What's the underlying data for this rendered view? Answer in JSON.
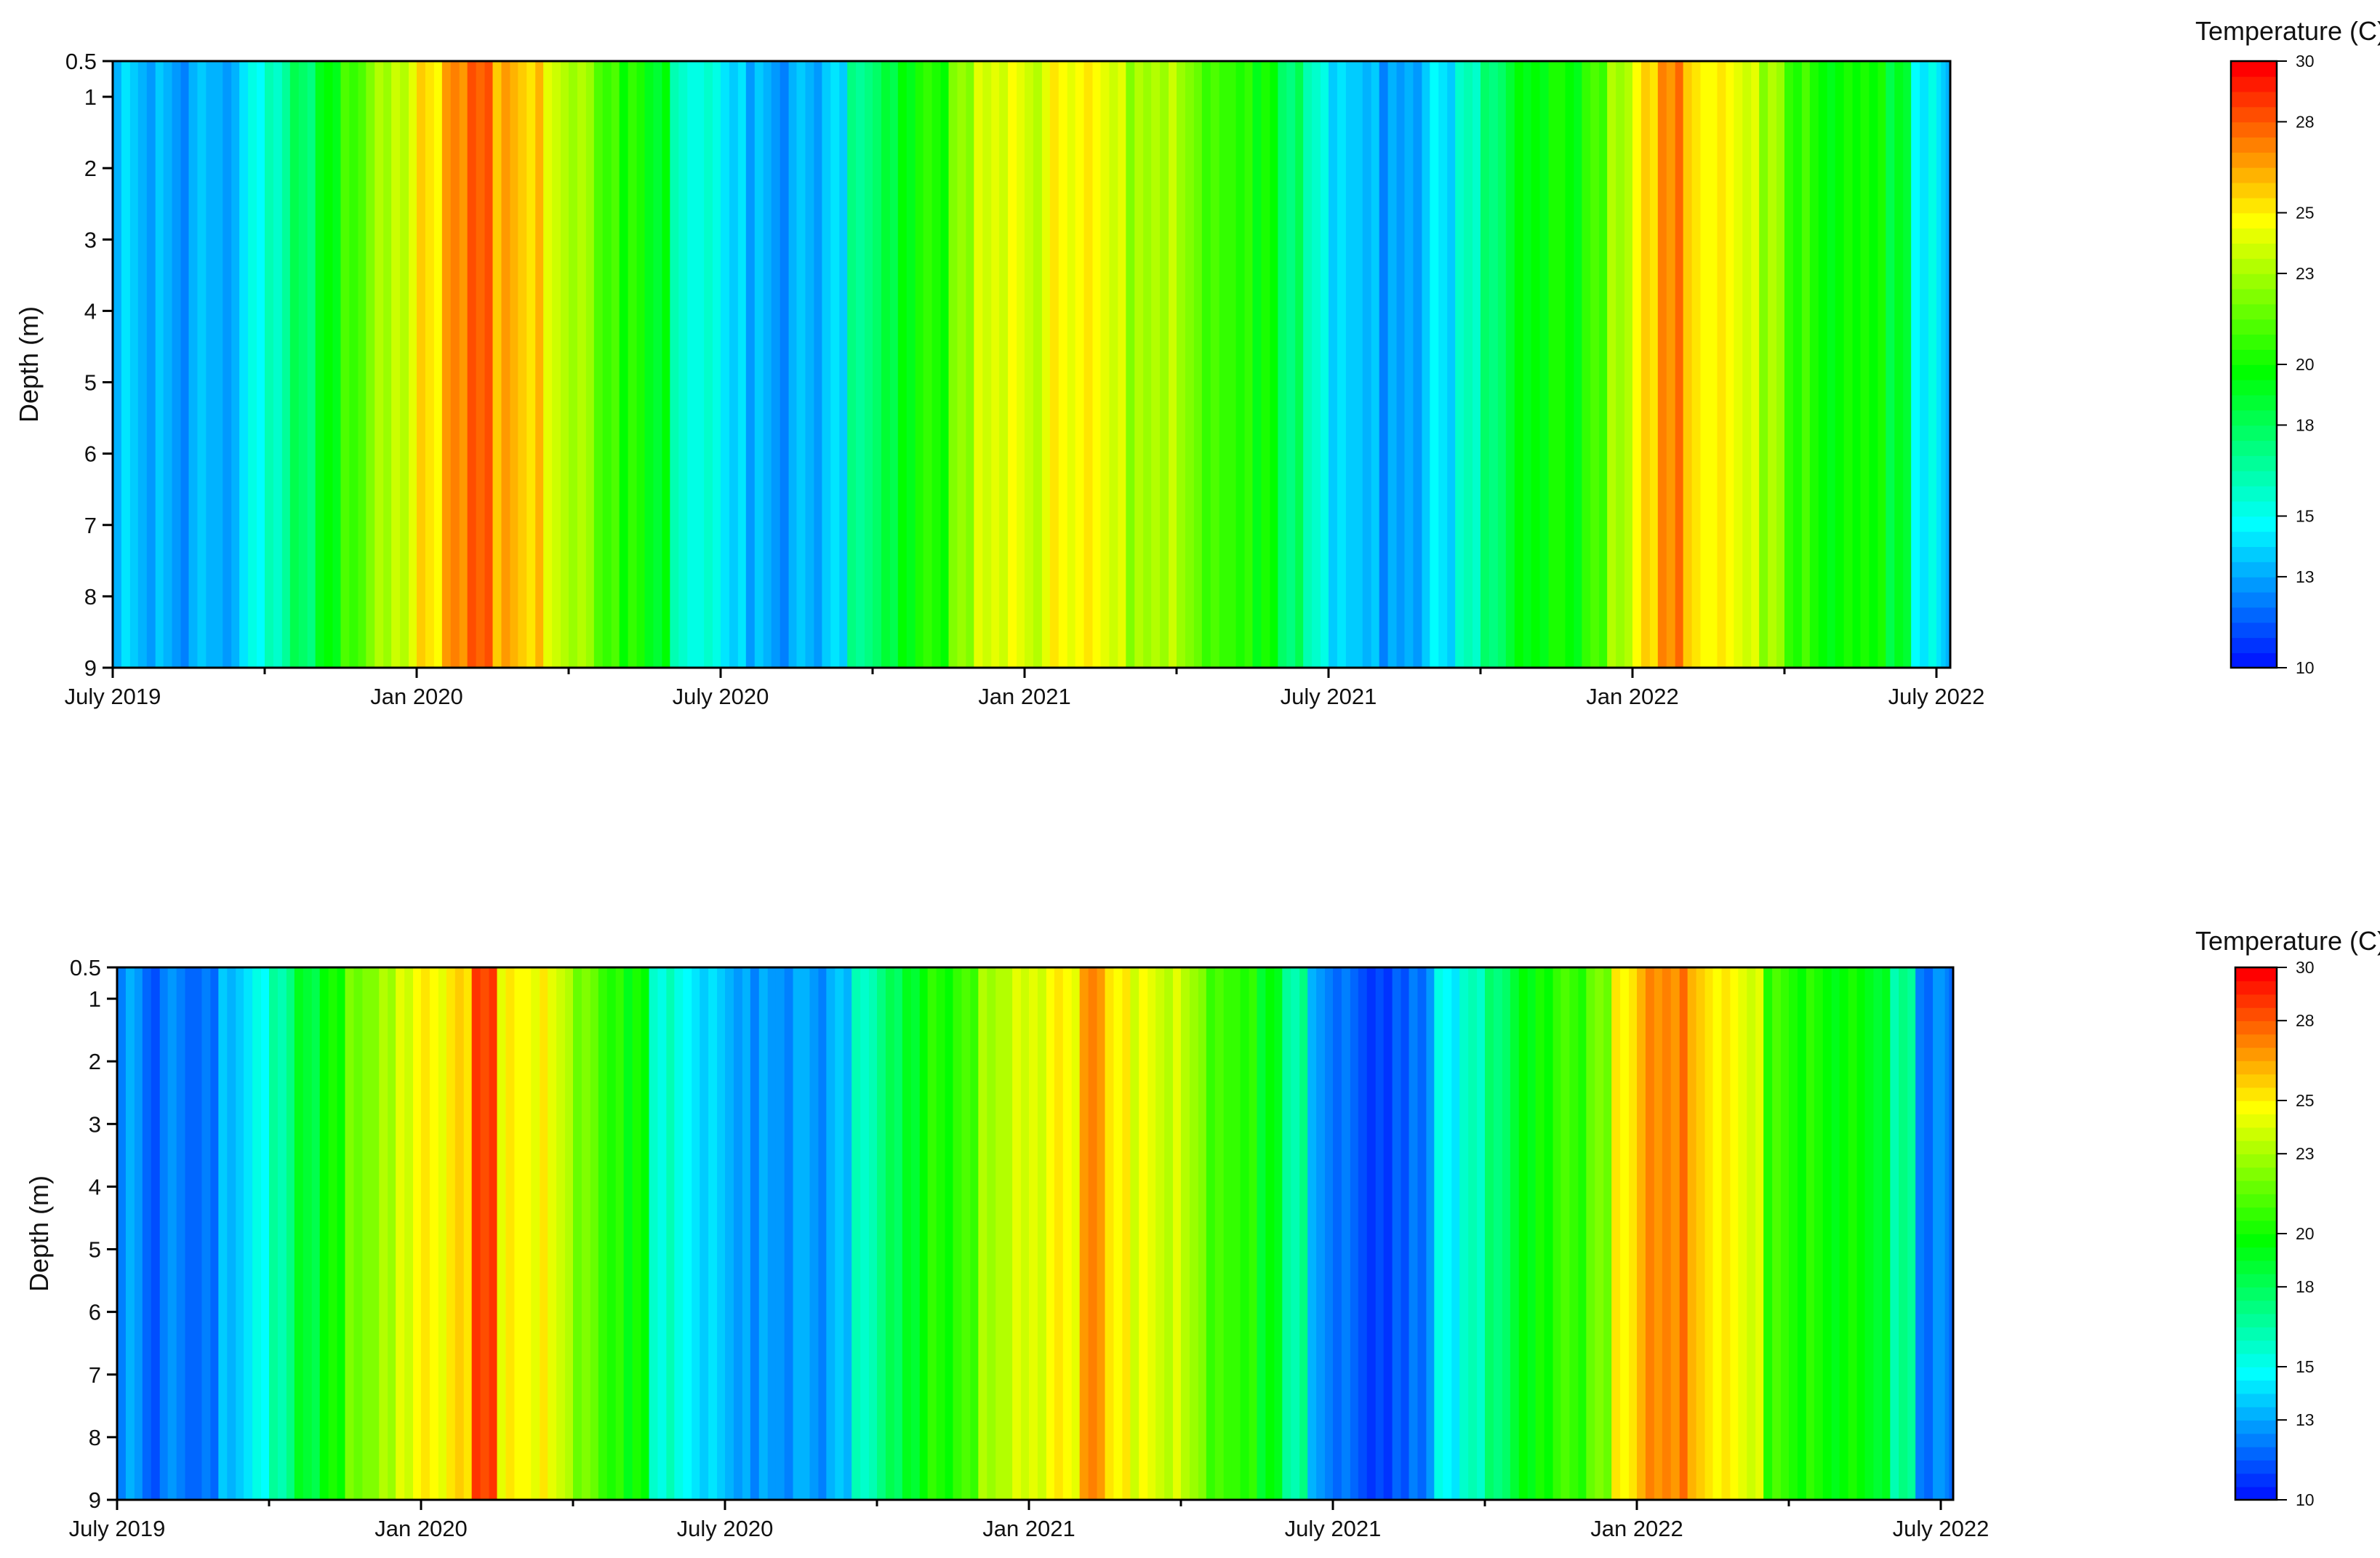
{
  "chart_data": [
    {
      "type": "heatmap",
      "title": "",
      "xlabel": "",
      "ylabel": "Depth (m)",
      "ylim": [
        0.5,
        9
      ],
      "yticks": [
        "0.5",
        "1",
        "2",
        "3",
        "4",
        "5",
        "6",
        "7",
        "8",
        "9"
      ],
      "ytick_values": [
        0.5,
        1,
        2,
        3,
        4,
        5,
        6,
        7,
        8,
        9
      ],
      "xticks": [
        "July 2019",
        "Jan 2020",
        "July 2020",
        "Jan 2021",
        "July 2021",
        "Jan 2022",
        "July 2022"
      ],
      "x_start": "2019-07-01",
      "x_step": "half-month",
      "colorbar": {
        "label": "Temperature (C)",
        "ticks": [
          "10",
          "13",
          "15",
          "18",
          "20",
          "23",
          "25",
          "28",
          "30"
        ],
        "range": [
          10,
          30
        ]
      },
      "surface_temps": [
        14,
        13.5,
        13,
        13.5,
        13,
        15,
        16.5,
        18,
        19.5,
        21,
        23,
        24,
        25.5,
        27,
        28,
        26.5,
        26,
        24,
        23,
        21,
        20.5,
        19.5,
        16,
        15.5,
        14,
        13.5,
        13,
        13.5,
        14,
        17,
        18.5,
        20,
        20.5,
        22.5,
        24,
        24.5,
        24,
        25,
        25,
        24,
        23,
        23.5,
        22.5,
        21,
        20.5,
        20,
        18,
        16,
        14,
        13.5,
        13,
        13.5,
        14.5,
        16,
        17.5,
        19.5,
        20,
        20,
        21,
        23,
        25.5,
        27.5,
        25.5,
        25,
        24,
        23,
        21,
        20,
        20,
        20,
        19,
        15,
        14
      ]
    },
    {
      "type": "heatmap",
      "title": "",
      "xlabel": "",
      "ylabel": "Depth (m)",
      "ylim": [
        0.5,
        9
      ],
      "yticks": [
        "0.5",
        "1",
        "2",
        "3",
        "4",
        "5",
        "6",
        "7",
        "8",
        "9"
      ],
      "ytick_values": [
        0.5,
        1,
        2,
        3,
        4,
        5,
        6,
        7,
        8,
        9
      ],
      "xticks": [
        "July 2019",
        "Jan 2020",
        "July 2020",
        "Jan 2021",
        "July 2021",
        "Jan 2022",
        "July 2022"
      ],
      "x_start": "2019-07-01",
      "x_step": "half-month",
      "colorbar": {
        "label": "Temperature (C)",
        "ticks": [
          "10",
          "13",
          "15",
          "18",
          "20",
          "23",
          "25",
          "28",
          "30"
        ],
        "range": [
          10,
          30
        ]
      },
      "surface_temps": [
        13,
        12,
        12.5,
        12,
        13.5,
        15,
        17,
        19,
        20,
        22,
        23,
        24.5,
        25,
        25.5,
        28.5,
        25,
        25,
        24,
        22,
        20.5,
        20,
        16,
        15,
        14,
        13,
        13,
        13,
        13,
        13.5,
        16,
        18,
        19.5,
        20.5,
        21,
        23,
        24,
        24.5,
        25,
        27,
        25,
        24.5,
        24,
        23,
        21,
        20.5,
        19.5,
        17,
        13,
        12,
        11,
        11.5,
        12.5,
        15,
        16,
        17.5,
        19.5,
        20.5,
        21,
        22,
        25,
        27,
        27.5,
        26,
        25,
        24,
        21,
        20.5,
        20,
        20,
        19,
        17,
        12.5,
        12.5
      ]
    }
  ]
}
